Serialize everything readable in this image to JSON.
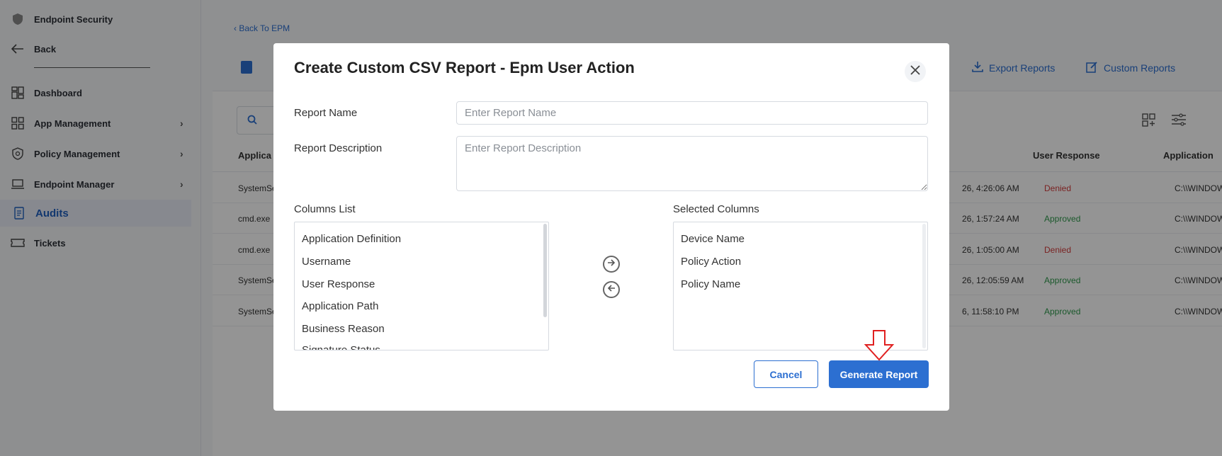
{
  "sidebar": {
    "product": "Endpoint Security",
    "back": "Back",
    "items": [
      {
        "label": "Dashboard",
        "icon": "dashboard-icon"
      },
      {
        "label": "App Management",
        "icon": "grid-icon"
      },
      {
        "label": "Policy Management",
        "icon": "shield-icon"
      },
      {
        "label": "Endpoint Manager",
        "icon": "laptop-icon"
      },
      {
        "label": "Audits",
        "icon": "document-icon"
      },
      {
        "label": "Tickets",
        "icon": "ticket-icon"
      }
    ]
  },
  "main": {
    "back_link": "Back To EPM",
    "export_reports": "Export Reports",
    "custom_reports": "Custom Reports",
    "table": {
      "headers": [
        "Applica",
        "User Response",
        "Application"
      ],
      "rows": [
        {
          "app": "SystemSe",
          "time": "26, 4:26:06 AM",
          "response": "Denied",
          "path": "C:\\\\WINDOWS"
        },
        {
          "app": "cmd.exe",
          "time": "26, 1:57:24 AM",
          "response": "Approved",
          "path": "C:\\\\WINDOWS"
        },
        {
          "app": "cmd.exe",
          "time": "26, 1:05:00 AM",
          "response": "Denied",
          "path": "C:\\\\WINDOWS"
        },
        {
          "app": "SystemSe",
          "time": "26, 12:05:59 AM",
          "response": "Approved",
          "path": "C:\\\\WINDOWS"
        },
        {
          "app": "SystemSe",
          "time": "6, 11:58:10 PM",
          "response": "Approved",
          "path": "C:\\\\WINDOWS"
        }
      ]
    }
  },
  "modal": {
    "title": "Create Custom CSV Report - Epm User Action",
    "report_name_label": "Report Name",
    "report_name_placeholder": "Enter Report Name",
    "report_desc_label": "Report Description",
    "report_desc_placeholder": "Enter Report Description",
    "columns_list_label": "Columns List",
    "selected_columns_label": "Selected Columns",
    "columns_list": [
      "Application Definition",
      "Username",
      "User Response",
      "Application Path",
      "Business Reason",
      "Signature Status"
    ],
    "selected_columns": [
      "Device Name",
      "Policy Action",
      "Policy Name"
    ],
    "cancel": "Cancel",
    "generate": "Generate Report"
  },
  "colors": {
    "accent": "#2c6fd1",
    "denied": "#d33b3b",
    "approved": "#2f9a4c",
    "annotation": "#e02020"
  }
}
